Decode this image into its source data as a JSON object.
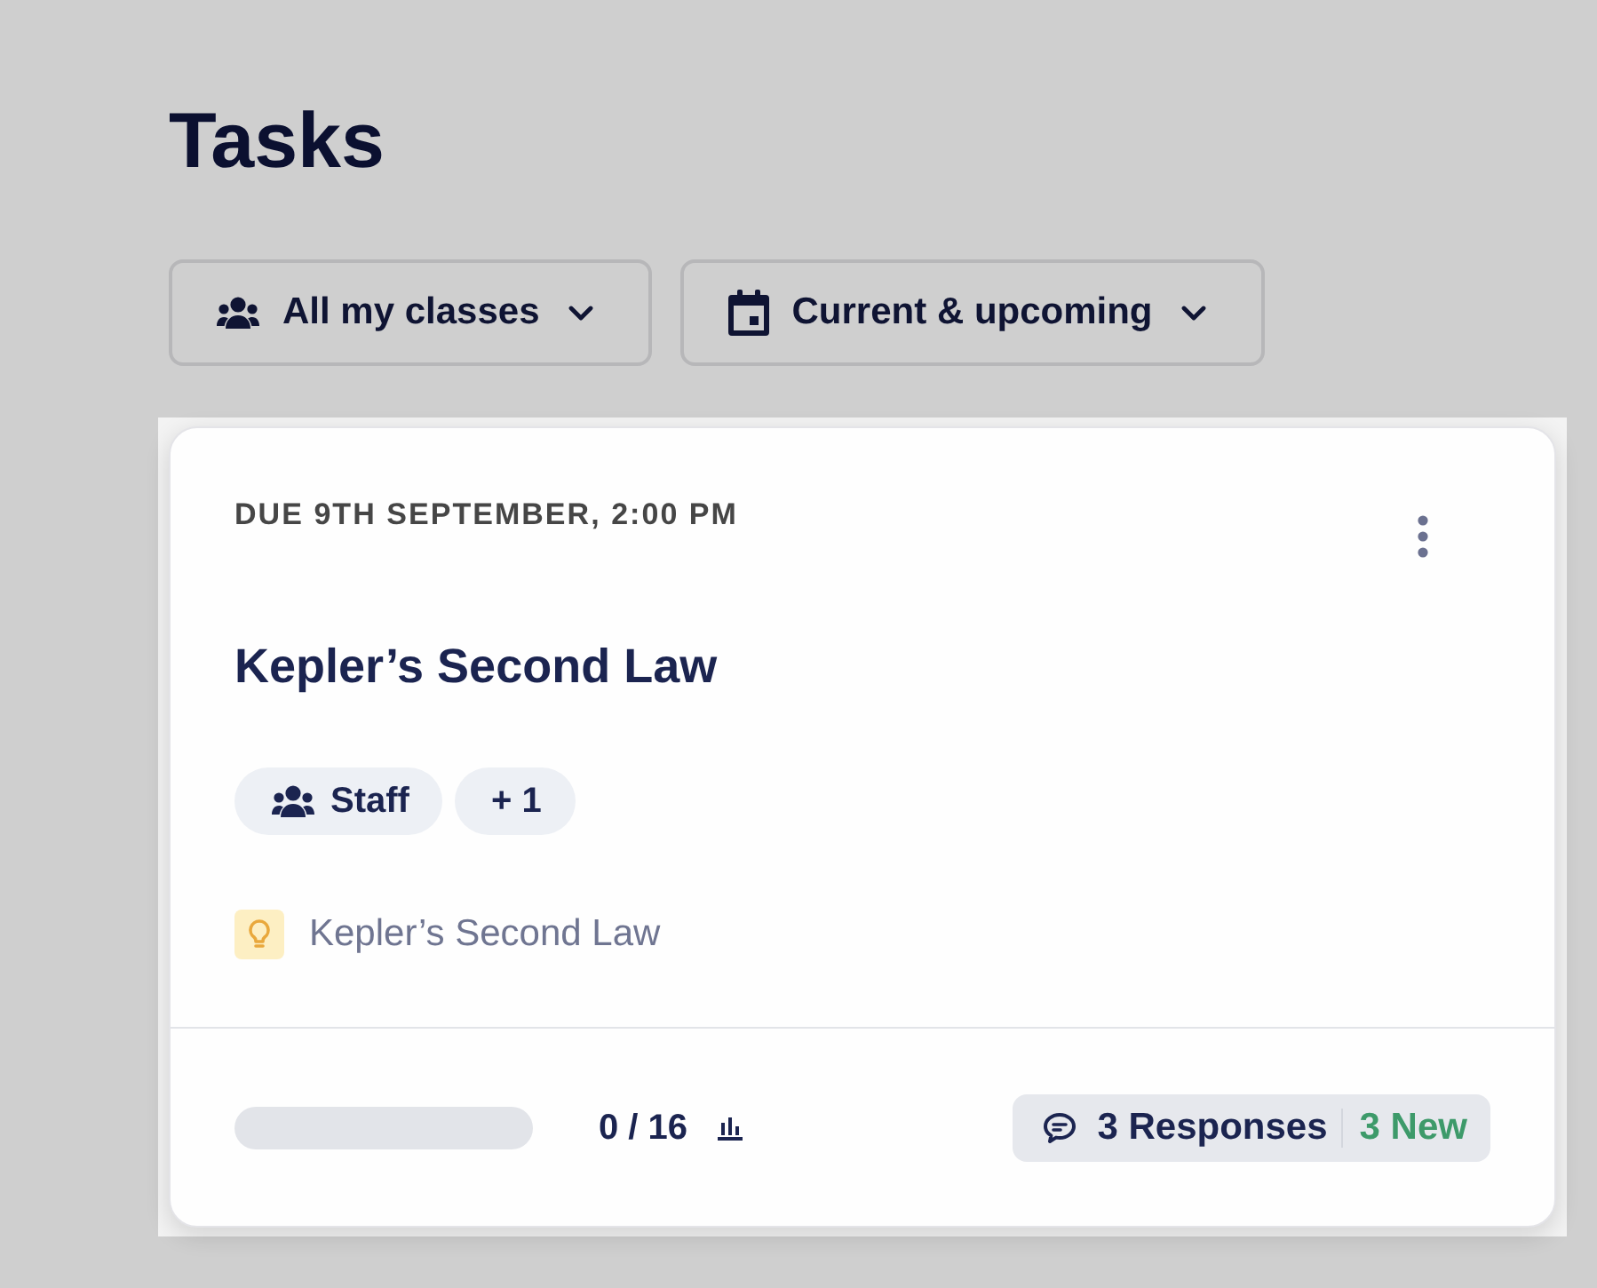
{
  "page": {
    "title": "Tasks"
  },
  "filters": [
    {
      "label": "All my classes",
      "kind": "group"
    },
    {
      "label": "Current & upcoming",
      "kind": "calendar"
    }
  ],
  "task_card": {
    "due": "DUE 9TH SEPTEMBER, 2:00 PM",
    "title": "Kepler’s Second Law",
    "tags": [
      {
        "label": "Staff",
        "kind": "group"
      },
      {
        "label": "+ 1",
        "kind": "count"
      }
    ],
    "resource": {
      "label": "Kepler’s Second Law"
    },
    "progress": {
      "level": 0,
      "reading": "0 / 16"
    },
    "responses": {
      "label": "3 Responses",
      "new": "3 New"
    }
  }
}
